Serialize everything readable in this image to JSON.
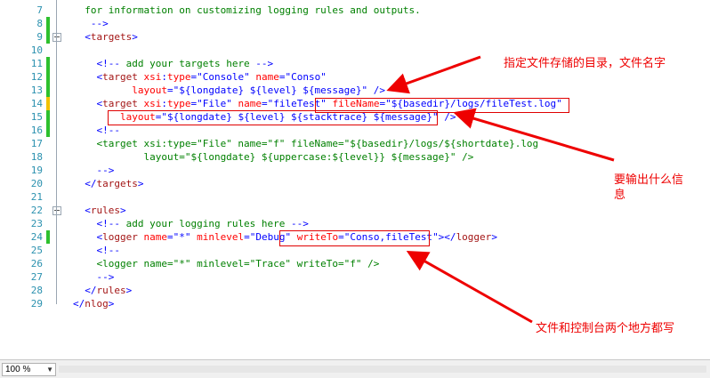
{
  "editor": {
    "lines": [
      {
        "num": "7",
        "parts": [
          {
            "t": "  for information on customizing logging rules and outputs.",
            "c": "c"
          }
        ]
      },
      {
        "num": "8",
        "parts": [
          {
            "t": "   -->",
            "c": "k"
          }
        ]
      },
      {
        "num": "9",
        "parts": [
          {
            "t": "  <",
            "c": "k"
          },
          {
            "t": "targets",
            "c": "t"
          },
          {
            "t": ">",
            "c": "k"
          }
        ]
      },
      {
        "num": "10",
        "parts": []
      },
      {
        "num": "11",
        "parts": [
          {
            "t": "    <!-- ",
            "c": "k"
          },
          {
            "t": "add your targets here",
            "c": "c"
          },
          {
            "t": " -->",
            "c": "k"
          }
        ]
      },
      {
        "num": "12",
        "parts": [
          {
            "t": "    <",
            "c": "k"
          },
          {
            "t": "target",
            "c": "t"
          },
          {
            "t": " ",
            "c": ""
          },
          {
            "t": "xsi",
            "c": "a"
          },
          {
            "t": ":",
            "c": "k"
          },
          {
            "t": "type",
            "c": "a"
          },
          {
            "t": "=\"",
            "c": "k"
          },
          {
            "t": "Console",
            "c": "v"
          },
          {
            "t": "\" ",
            "c": "k"
          },
          {
            "t": "name",
            "c": "a"
          },
          {
            "t": "=\"",
            "c": "k"
          },
          {
            "t": "Conso",
            "c": "v"
          },
          {
            "t": "\"",
            "c": "k"
          }
        ]
      },
      {
        "num": "13",
        "parts": [
          {
            "t": "          ",
            "c": ""
          },
          {
            "t": "layout",
            "c": "a"
          },
          {
            "t": "=\"",
            "c": "k"
          },
          {
            "t": "${longdate} ${level} ${message}",
            "c": "v"
          },
          {
            "t": "\" />",
            "c": "k"
          }
        ]
      },
      {
        "num": "14",
        "parts": [
          {
            "t": "    <",
            "c": "k"
          },
          {
            "t": "target",
            "c": "t"
          },
          {
            "t": " ",
            "c": ""
          },
          {
            "t": "xsi",
            "c": "a"
          },
          {
            "t": ":",
            "c": "k"
          },
          {
            "t": "type",
            "c": "a"
          },
          {
            "t": "=\"",
            "c": "k"
          },
          {
            "t": "File",
            "c": "v"
          },
          {
            "t": "\" ",
            "c": "k"
          },
          {
            "t": "name",
            "c": "a"
          },
          {
            "t": "=\"",
            "c": "k"
          },
          {
            "t": "fileTest",
            "c": "v"
          },
          {
            "t": "\" ",
            "c": "k"
          },
          {
            "t": "fileName",
            "c": "a"
          },
          {
            "t": "=\"",
            "c": "k"
          },
          {
            "t": "${basedir}/logs/fileTest.log",
            "c": "v"
          },
          {
            "t": "\"",
            "c": "k"
          }
        ]
      },
      {
        "num": "15",
        "parts": [
          {
            "t": "        ",
            "c": ""
          },
          {
            "t": "layout",
            "c": "a"
          },
          {
            "t": "=\"",
            "c": "k"
          },
          {
            "t": "${longdate} ${level} ${stacktrace} ${message}",
            "c": "v"
          },
          {
            "t": "\" />",
            "c": "k"
          }
        ]
      },
      {
        "num": "16",
        "parts": [
          {
            "t": "    <!--",
            "c": "k"
          }
        ]
      },
      {
        "num": "17",
        "parts": [
          {
            "t": "    <target xsi:type=\"File\" name=\"f\" fileName=\"${basedir}/logs/${shortdate}.log",
            "c": "c"
          }
        ]
      },
      {
        "num": "18",
        "parts": [
          {
            "t": "            layout=\"${longdate} ${uppercase:${level}} ${message}\" />",
            "c": "c"
          }
        ]
      },
      {
        "num": "19",
        "parts": [
          {
            "t": "    -->",
            "c": "k"
          }
        ]
      },
      {
        "num": "20",
        "parts": [
          {
            "t": "  </",
            "c": "k"
          },
          {
            "t": "targets",
            "c": "t"
          },
          {
            "t": ">",
            "c": "k"
          }
        ]
      },
      {
        "num": "21",
        "parts": []
      },
      {
        "num": "22",
        "parts": [
          {
            "t": "  <",
            "c": "k"
          },
          {
            "t": "rules",
            "c": "t"
          },
          {
            "t": ">",
            "c": "k"
          }
        ]
      },
      {
        "num": "23",
        "parts": [
          {
            "t": "    <!-- ",
            "c": "k"
          },
          {
            "t": "add your logging rules here",
            "c": "c"
          },
          {
            "t": " -->",
            "c": "k"
          }
        ]
      },
      {
        "num": "24",
        "parts": [
          {
            "t": "    <",
            "c": "k"
          },
          {
            "t": "logger",
            "c": "t"
          },
          {
            "t": " ",
            "c": ""
          },
          {
            "t": "name",
            "c": "a"
          },
          {
            "t": "=\"",
            "c": "k"
          },
          {
            "t": "*",
            "c": "v"
          },
          {
            "t": "\" ",
            "c": "k"
          },
          {
            "t": "minlevel",
            "c": "a"
          },
          {
            "t": "=\"",
            "c": "k"
          },
          {
            "t": "Debug",
            "c": "v"
          },
          {
            "t": "\" ",
            "c": "k"
          },
          {
            "t": "writeTo",
            "c": "a"
          },
          {
            "t": "=\"",
            "c": "k"
          },
          {
            "t": "Conso,fileTest",
            "c": "v"
          },
          {
            "t": "\"></",
            "c": "k"
          },
          {
            "t": "logger",
            "c": "t"
          },
          {
            "t": ">",
            "c": "k"
          }
        ]
      },
      {
        "num": "25",
        "parts": [
          {
            "t": "    <!--",
            "c": "k"
          }
        ]
      },
      {
        "num": "26",
        "parts": [
          {
            "t": "    <logger name=\"*\" minlevel=\"Trace\" writeTo=\"f\" />",
            "c": "c"
          }
        ]
      },
      {
        "num": "27",
        "parts": [
          {
            "t": "    -->",
            "c": "k"
          }
        ]
      },
      {
        "num": "28",
        "parts": [
          {
            "t": "  </",
            "c": "k"
          },
          {
            "t": "rules",
            "c": "t"
          },
          {
            "t": ">",
            "c": "k"
          }
        ]
      },
      {
        "num": "29",
        "parts": [
          {
            "t": "</",
            "c": "k"
          },
          {
            "t": "nlog",
            "c": "t"
          },
          {
            "t": ">",
            "c": "k"
          }
        ]
      }
    ]
  },
  "annotations": {
    "note_directory": "指定文件存储的目录，文件名字",
    "note_output_line1": "要输出什么信",
    "note_output_line2": "息",
    "note_write_both": "文件和控制台两个地方都写"
  },
  "colors": {
    "annotation_red": "#ee0000",
    "change_green": "#2ec02e",
    "change_yellow": "#f2c200"
  },
  "statusbar": {
    "zoom": "100 %"
  }
}
